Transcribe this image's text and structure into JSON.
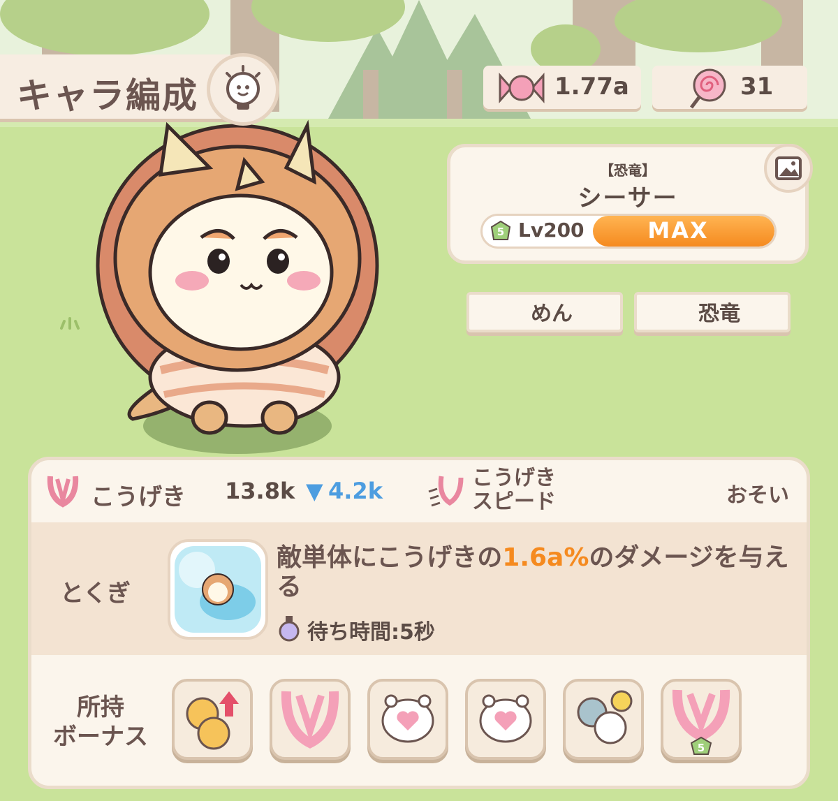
{
  "header": {
    "title": "キャラ編成",
    "hint_icon": "lightbulb-icon"
  },
  "currency": {
    "candy": {
      "icon": "candy-icon",
      "value": "1.77a"
    },
    "lollipop": {
      "icon": "lollipop-icon",
      "value": "31"
    }
  },
  "character": {
    "tag": "【恐竜】",
    "name": "シーサー",
    "rank_badge": "5",
    "level": "Lv200",
    "level_status": "MAX",
    "level_progress": 1.0,
    "photo_icon": "image-icon"
  },
  "type_tags": [
    "めん",
    "恐竜"
  ],
  "stats": {
    "attack_label": "こうげき",
    "attack_value": "13.8k",
    "attack_diff": "4.2k",
    "speed_label_line1": "こうげき",
    "speed_label_line2": "スピード",
    "speed_value": "おそい"
  },
  "skill": {
    "label": "とくぎ",
    "desc_part1": "敵単体にこうげきの",
    "desc_highlight": "1.6a%",
    "desc_part2": "のダメージを与える",
    "wait_label": "待ち時間:5秒"
  },
  "bonus": {
    "label_line1": "所持",
    "label_line2": "ボーナス",
    "items": [
      {
        "icon": "coin-up-icon"
      },
      {
        "icon": "claw-icon"
      },
      {
        "icon": "heart-face-icon"
      },
      {
        "icon": "heart-face-icon"
      },
      {
        "icon": "cloud-sun-icon"
      },
      {
        "icon": "claw-rank-icon",
        "rank": "5"
      }
    ]
  },
  "colors": {
    "grass": "#c9e39a",
    "panel": "#fbf5ec",
    "accent_orange": "#f58a1f",
    "accent_blue": "#4d9de0"
  }
}
